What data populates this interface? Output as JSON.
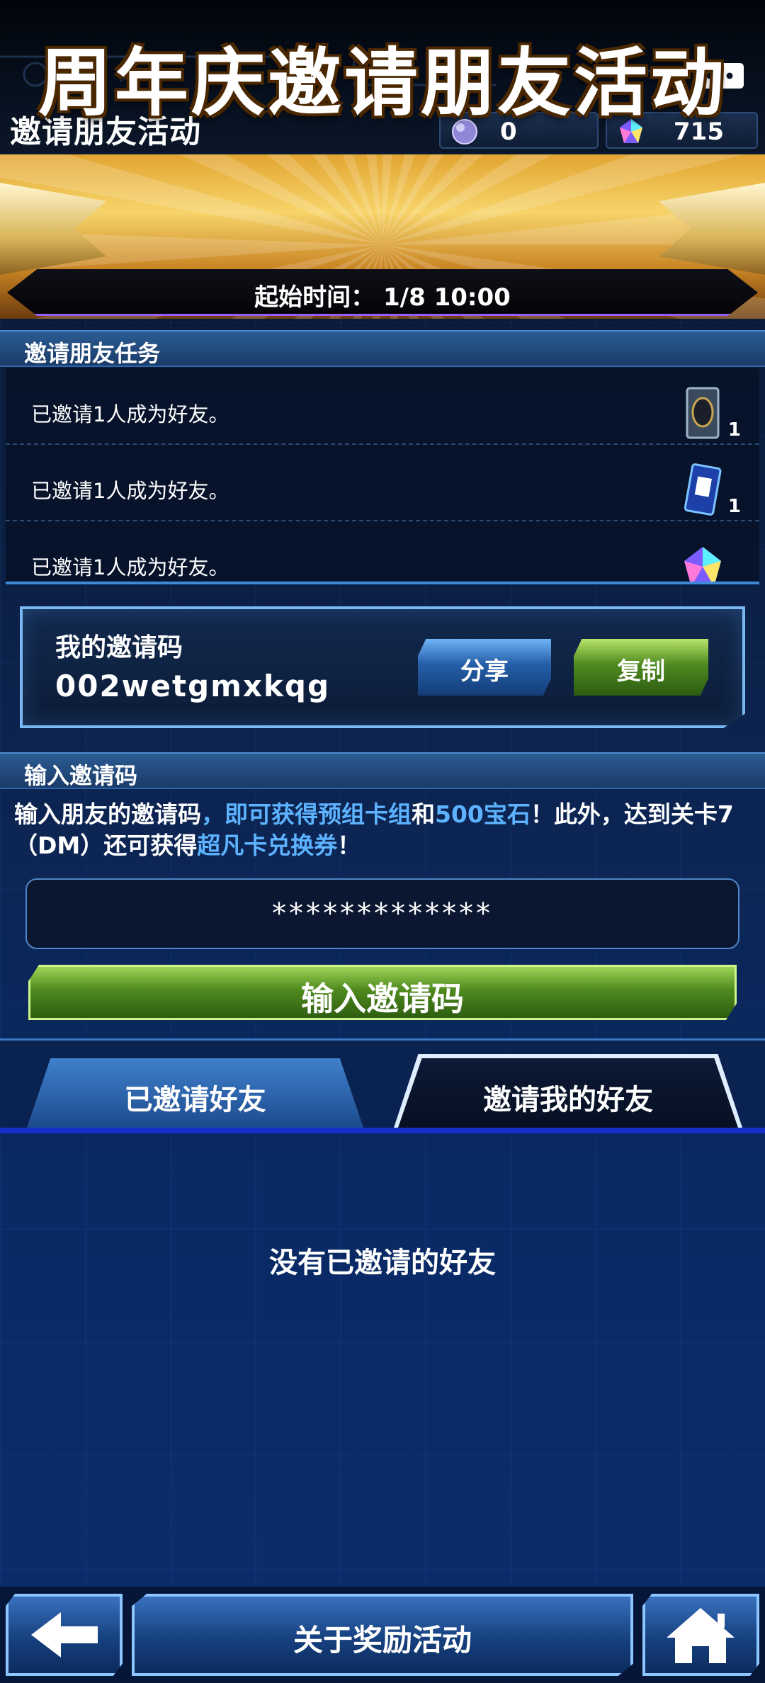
{
  "header": {
    "title": "邀请朋友活动",
    "orb_count": "0",
    "gem_count": "715",
    "orb_icon": "orb-icon",
    "gem_icon": "gem-icon",
    "chat_icon": "chat-bubble-icon"
  },
  "banner": {
    "title": "周年庆邀请朋友活动",
    "start_time": "起始时间：  1/8 10:00"
  },
  "tasks": {
    "header": "邀请朋友任务",
    "items": [
      {
        "text": "已邀请1人成为好友。",
        "reward_icon": "deck-box-icon",
        "quantity": "1"
      },
      {
        "text": "已邀请1人成为好友。",
        "reward_icon": "card-ticket-icon",
        "quantity": "1"
      },
      {
        "text": "已邀请1人成为好友。",
        "reward_icon": "gem-icon",
        "quantity": ""
      }
    ]
  },
  "invite_code": {
    "label": "我的邀请码",
    "value": "002wetgmxkqg",
    "share_label": "分享",
    "copy_label": "复制"
  },
  "enter_code": {
    "header": "输入邀请码",
    "desc_part1": "输入朋友的邀请码",
    "desc_hl1": "，即可获得预组卡组",
    "desc_part2": "和",
    "desc_hl2": "500宝石",
    "desc_part3": "！此外，达到关卡7（DM）还可获得",
    "desc_hl3": "超凡卡兑换券",
    "desc_part4": "！",
    "input_value": "*************",
    "submit_label": "输入邀请码"
  },
  "tabs": {
    "invited": "已邀请好友",
    "invited_me": "邀请我的好友",
    "active": "invited_me"
  },
  "empty_message": "没有已邀请的好友",
  "footer": {
    "back_icon": "back-arrow-icon",
    "about_label": "关于奖励活动",
    "home_icon": "home-icon"
  },
  "colors": {
    "accent_blue": "#5db3ff",
    "confirm_green": "#4f8a20",
    "banner_gold": "#f7d46a"
  }
}
